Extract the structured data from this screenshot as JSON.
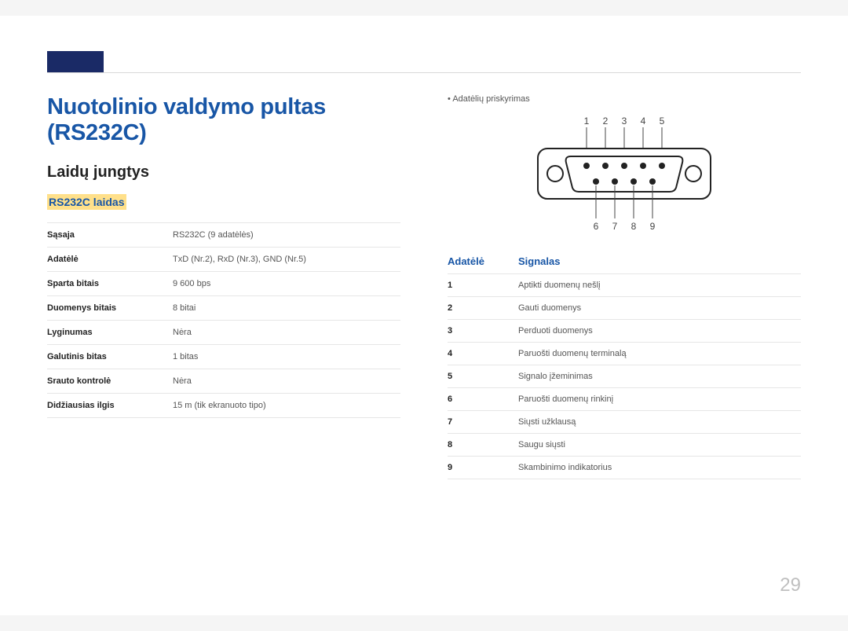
{
  "heading": "Nuotolinio valdymo pultas (RS232C)",
  "section": "Laidų jungtys",
  "subheading": "RS232C laidas",
  "spec_table": [
    {
      "k": "Sąsaja",
      "v": "RS232C (9 adatėlės)"
    },
    {
      "k": "Adatėlė",
      "v": "TxD (Nr.2), RxD (Nr.3), GND (Nr.5)"
    },
    {
      "k": "Sparta bitais",
      "v": "9 600 bps"
    },
    {
      "k": "Duomenys bitais",
      "v": "8 bitai"
    },
    {
      "k": "Lyginumas",
      "v": "Nėra"
    },
    {
      "k": "Galutinis bitas",
      "v": "1 bitas"
    },
    {
      "k": "Srauto kontrolė",
      "v": "Nėra"
    },
    {
      "k": "Didžiausias ilgis",
      "v": "15 m (tik ekranuoto tipo)"
    }
  ],
  "right_bullet": "Adatėlių priskyrimas",
  "connector": {
    "top_labels": [
      "1",
      "2",
      "3",
      "4",
      "5"
    ],
    "bottom_labels": [
      "6",
      "7",
      "8",
      "9"
    ]
  },
  "pin_table": {
    "headers": {
      "pin": "Adatėlė",
      "signal": "Signalas"
    },
    "rows": [
      {
        "pin": "1",
        "signal": "Aptikti duomenų nešlį"
      },
      {
        "pin": "2",
        "signal": "Gauti duomenys"
      },
      {
        "pin": "3",
        "signal": "Perduoti duomenys"
      },
      {
        "pin": "4",
        "signal": "Paruošti duomenų terminalą"
      },
      {
        "pin": "5",
        "signal": "Signalo įžeminimas"
      },
      {
        "pin": "6",
        "signal": "Paruošti duomenų rinkinį"
      },
      {
        "pin": "7",
        "signal": "Siųsti užklausą"
      },
      {
        "pin": "8",
        "signal": "Saugu siųsti"
      },
      {
        "pin": "9",
        "signal": "Skambinimo indikatorius"
      }
    ]
  },
  "page_number": "29"
}
